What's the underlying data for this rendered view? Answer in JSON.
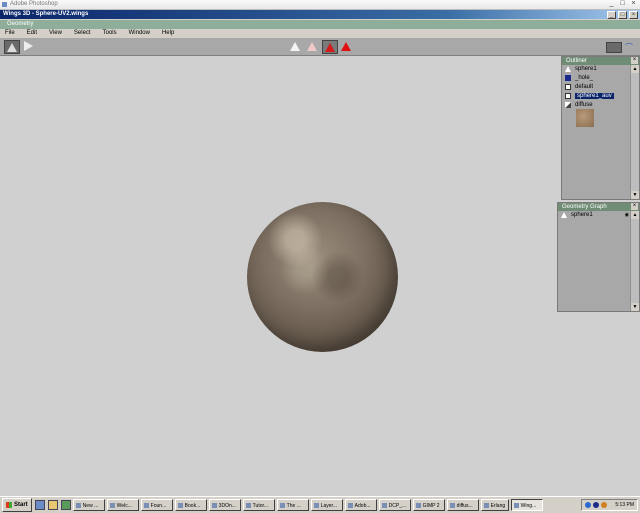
{
  "photoshop": {
    "title": "Adobe Photoshop"
  },
  "wings": {
    "title": "Wings 3D - Sphere-UV2.wings"
  },
  "geometry_strip": {
    "label": "Geometry"
  },
  "menu": [
    "File",
    "Edit",
    "View",
    "Select",
    "Tools",
    "Window",
    "Help"
  ],
  "outliner": {
    "title": "Outliner",
    "items": [
      {
        "label": "sphere1",
        "icon": "object-icon"
      },
      {
        "label": "_hole_",
        "icon": "material-swatch-icon"
      },
      {
        "label": "default",
        "icon": "material-swatch-icon"
      },
      {
        "label": "sphere1_auv",
        "icon": "material-swatch-icon",
        "selected": true
      },
      {
        "label": "diffuse",
        "icon": "image-icon"
      }
    ]
  },
  "geometry_graph": {
    "title": "Geometry Graph",
    "items": [
      {
        "label": "sphere1"
      }
    ]
  },
  "taskbar": {
    "start_label": "Start",
    "tasks": [
      "New ...",
      "Welc...",
      "Foun...",
      "Book...",
      "3DOn...",
      "Tutor...",
      "The ...",
      "Layer...",
      "Adob...",
      "DCP_...",
      "GIMP 2",
      "diffus...",
      "Erlang",
      "Wing..."
    ],
    "clock": "5:13 PM"
  }
}
